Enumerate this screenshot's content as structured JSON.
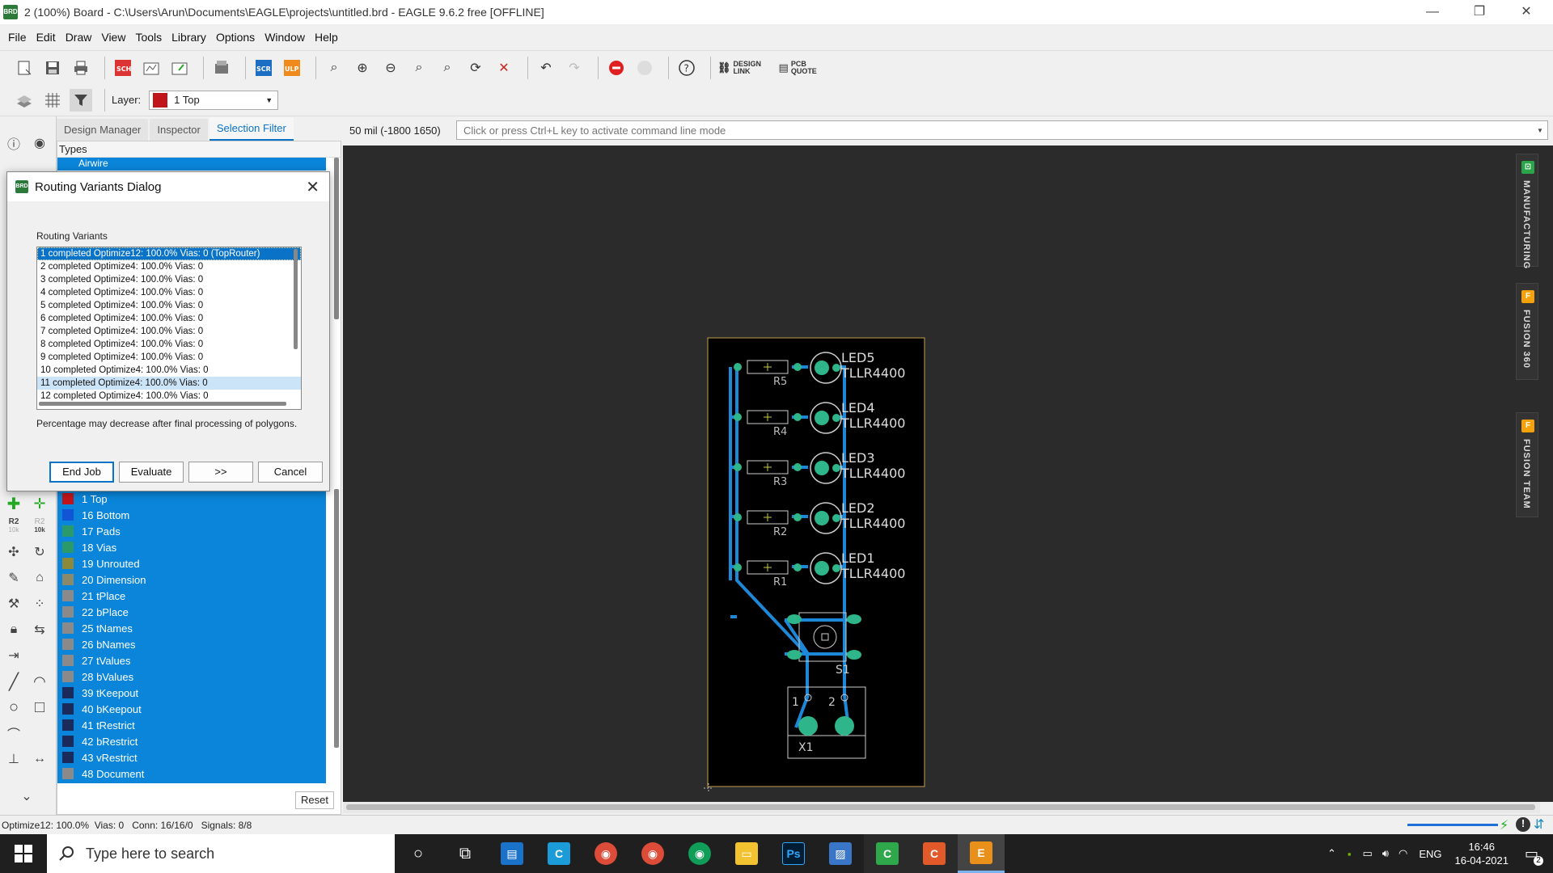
{
  "window": {
    "title": "2 (100%) Board - C:\\Users\\Arun\\Documents\\EAGLE\\projects\\untitled.brd - EAGLE 9.6.2 free [OFFLINE]",
    "app_icon_text": "BRD",
    "minimize": "—",
    "restore": "❐",
    "close": "✕"
  },
  "menu": [
    "File",
    "Edit",
    "Draw",
    "View",
    "Tools",
    "Library",
    "Options",
    "Window",
    "Help"
  ],
  "toolbar": {
    "design_link": "DESIGN LINK",
    "pcb_quote": "PCB QUOTE",
    "scr": "SCR",
    "ulp": "ULP",
    "sch": "SCH"
  },
  "layer_selector": {
    "label": "Layer:",
    "value": "1 Top",
    "color": "#c0161b"
  },
  "left_panel": {
    "tabs": [
      "Design Manager",
      "Inspector",
      "Selection Filter"
    ],
    "types_header": "Types",
    "types_first_item": "Airwire",
    "reset": "Reset",
    "layers": [
      {
        "name": "1 Top",
        "color": "#c0161b"
      },
      {
        "name": "16 Bottom",
        "color": "#1155d6"
      },
      {
        "name": "17 Pads",
        "color": "#2a9a6a"
      },
      {
        "name": "18 Vias",
        "color": "#2a9a6a"
      },
      {
        "name": "19 Unrouted",
        "color": "#8a8a3a"
      },
      {
        "name": "20 Dimension",
        "color": "#8a8a6a"
      },
      {
        "name": "21 tPlace",
        "color": "#8a8a8a"
      },
      {
        "name": "22 bPlace",
        "color": "#8a8a8a"
      },
      {
        "name": "25 tNames",
        "color": "#8a8a8a"
      },
      {
        "name": "26 bNames",
        "color": "#8a8a8a"
      },
      {
        "name": "27 tValues",
        "color": "#8a8a8a"
      },
      {
        "name": "28 bValues",
        "color": "#8a8a8a"
      },
      {
        "name": "39 tKeepout",
        "color": "#1a2a5a"
      },
      {
        "name": "40 bKeepout",
        "color": "#1a2a5a"
      },
      {
        "name": "41 tRestrict",
        "color": "#1a2a5a"
      },
      {
        "name": "42 bRestrict",
        "color": "#1a2a5a"
      },
      {
        "name": "43 vRestrict",
        "color": "#1a2a5a"
      },
      {
        "name": "48 Document",
        "color": "#8a8a8a"
      }
    ]
  },
  "left_icons": {
    "r2": "R2",
    "r2_sub": "10k",
    "r2b": "R2",
    "r2b_sub": "10k"
  },
  "command_bar": {
    "coordinate": "50 mil (-1800 1650)",
    "placeholder": "Click or press Ctrl+L key to activate command line mode"
  },
  "dialog": {
    "title": "Routing Variants Dialog",
    "list_label": "Routing Variants",
    "variants": [
      "1 completed Optimize12:  100.0%  Vias: 0 (TopRouter)",
      "2 completed Optimize4:  100.0%  Vias: 0",
      "3 completed Optimize4:  100.0%  Vias: 0",
      "4 completed Optimize4:  100.0%  Vias: 0",
      "5 completed Optimize4:  100.0%  Vias: 0",
      "6 completed Optimize4:  100.0%  Vias: 0",
      "7 completed Optimize4:  100.0%  Vias: 0",
      "8 completed Optimize4:  100.0%  Vias: 0",
      "9 completed Optimize4:  100.0%  Vias: 0",
      "10 completed Optimize4:  100.0%  Vias: 0",
      "11 completed Optimize4:  100.0%  Vias: 0",
      "12 completed Optimize4:  100.0%  Vias: 0"
    ],
    "note": "Percentage may decrease after final processing of polygons.",
    "buttons": {
      "end_job": "End Job",
      "evaluate": "Evaluate",
      "next": ">>",
      "cancel": "Cancel"
    }
  },
  "board": {
    "leds": [
      {
        "name": "LED5",
        "value": "TLLR4400",
        "res": "R5"
      },
      {
        "name": "LED4",
        "value": "TLLR4400",
        "res": "R4"
      },
      {
        "name": "LED3",
        "value": "TLLR4400",
        "res": "R3"
      },
      {
        "name": "LED2",
        "value": "TLLR4400",
        "res": "R2"
      },
      {
        "name": "LED1",
        "value": "TLLR4400",
        "res": "R1"
      }
    ],
    "switch_label": "S1",
    "connector_label": "X1",
    "pin1": "1",
    "pin2": "2",
    "trace_color": "#1e88d8",
    "pad_color": "#2fb58a"
  },
  "right_tabs": [
    {
      "label": "MANUFACTURING",
      "badge": "⊡",
      "color": "#2aa54a"
    },
    {
      "label": "FUSION 360",
      "badge": "F",
      "color": "#f5a10a"
    },
    {
      "label": "FUSION TEAM",
      "badge": "F",
      "color": "#f5a10a"
    }
  ],
  "status": "Optimize12: 100.0%  Vias: 0   Conn: 16/16/0   Signals: 8/8",
  "taskbar": {
    "search_placeholder": "Type here to search",
    "lang": "ENG",
    "time": "16:46",
    "date": "16-04-2021",
    "notif_count": "2"
  }
}
